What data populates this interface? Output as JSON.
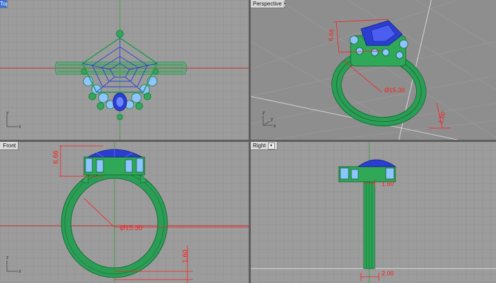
{
  "viewports": {
    "top": {
      "tab": "Top"
    },
    "perspective": {
      "tab": "Perspective"
    },
    "front": {
      "tab": "Front"
    },
    "right": {
      "tab": "Right"
    }
  },
  "dimensions": {
    "height": "6.66",
    "ring_diameter": "Ø15.30",
    "band_thickness": "1.60",
    "band_width_right": "1.60",
    "base_width": "2.00"
  },
  "axes": {
    "x": "x",
    "y": "y",
    "z": "z"
  },
  "colors": {
    "grid_bg": "#9a9a9a",
    "persp_bg": "#8c8c8c",
    "wire_green": "#1a9a4a",
    "gem_blue": "#2a3fd0",
    "accent_blue": "#8ec4ff",
    "dimension_red": "#ff1a1a"
  }
}
